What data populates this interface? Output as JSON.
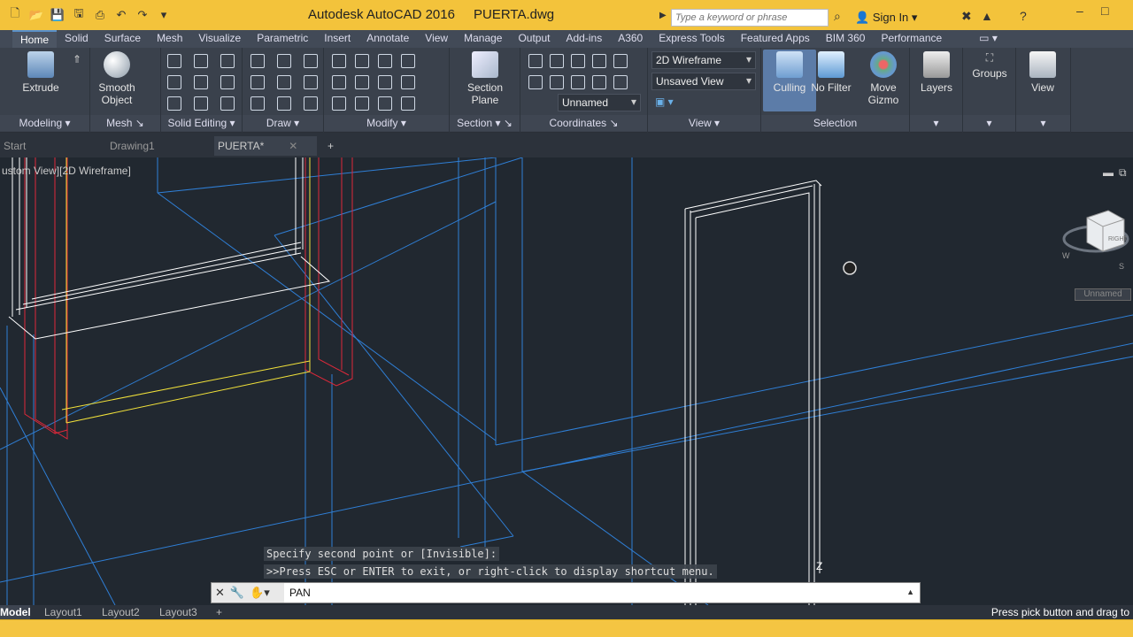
{
  "titlebar": {
    "app_title": "Autodesk AutoCAD 2016",
    "doc_title": "PUERTA.dwg",
    "search_placeholder": "Type a keyword or phrase",
    "sign_in": "Sign In"
  },
  "ribbon_tabs": [
    "Home",
    "Solid",
    "Surface",
    "Mesh",
    "Visualize",
    "Parametric",
    "Insert",
    "Annotate",
    "View",
    "Manage",
    "Output",
    "Add-ins",
    "A360",
    "Express Tools",
    "Featured Apps",
    "BIM 360",
    "Performance"
  ],
  "ribbon": {
    "extrude": "Extrude",
    "smooth_object": "Smooth Object",
    "section_plane": "Section Plane",
    "culling": "Culling",
    "no_filter": "No Filter",
    "move_gizmo": "Move Gizmo",
    "layers": "Layers",
    "groups": "Groups",
    "view": "View",
    "visual_style": "2D Wireframe",
    "saved_view": "Unsaved View",
    "ucs_name": "Unnamed",
    "panels": {
      "modeling": "Modeling",
      "mesh": "Mesh",
      "solid_editing": "Solid Editing",
      "draw": "Draw",
      "modify": "Modify",
      "section": "Section",
      "coordinates": "Coordinates",
      "view": "View",
      "selection": "Selection"
    }
  },
  "doc_tabs": {
    "start": "Start",
    "drawing1": "Drawing1",
    "puerta": "PUERTA*"
  },
  "viewport": {
    "label": "ustom View][2D Wireframe]",
    "viewcube_face": "RIGHT",
    "compass_w": "W",
    "compass_s": "S",
    "ucs_label": "Unnamed"
  },
  "command": {
    "history": [
      "Specify second point or [Invisible]:",
      ">>Press ESC or ENTER to exit, or right-click to display shortcut menu."
    ],
    "input": "PAN"
  },
  "layout_tabs": [
    "Model",
    "Layout1",
    "Layout2",
    "Layout3"
  ],
  "status": {
    "message": "Press pick button and drag to"
  },
  "colors": {
    "title_bar": "#f3c33b",
    "ribbon": "#3a414c",
    "viewport": "#212830",
    "wire_blue": "#2f7fd6",
    "wire_red": "#e0283a",
    "wire_yellow": "#f2e23a",
    "wire_white": "#ffffff"
  }
}
